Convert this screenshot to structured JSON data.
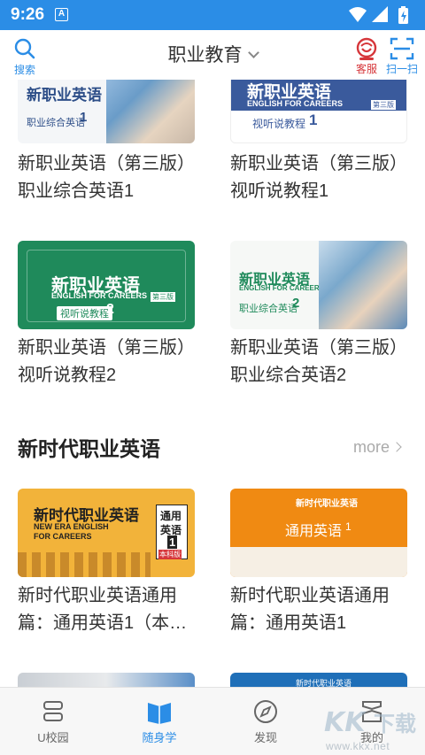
{
  "status_bar": {
    "time": "9:26",
    "notif": "A"
  },
  "header": {
    "search_label": "搜索",
    "title": "职业教育",
    "service_label": "客服",
    "scan_label": "扫一扫"
  },
  "books_top": [
    {
      "title": "新职业英语（第三版）职业综合英语1",
      "cover_title": "新职业英语",
      "cover_sub": "职业综合英语",
      "cover_num": "1"
    },
    {
      "title": "新职业英语（第三版）视听说教程1",
      "cover_title": "新职业英语",
      "cover_en": "ENGLISH FOR CAREERS",
      "cover_sub": "视听说教程",
      "cover_num": "1",
      "badge": "第三版"
    },
    {
      "title": "新职业英语（第三版）视听说教程2",
      "cover_title": "新职业英语",
      "cover_en": "ENGLISH FOR CAREERS",
      "cover_sub": "视听说教程",
      "cover_num": "2",
      "badge": "第三版"
    },
    {
      "title": "新职业英语（第三版）职业综合英语2",
      "cover_title": "新职业英语",
      "cover_en": "ENGLISH FOR CAREERS",
      "cover_sub": "职业综合英语",
      "cover_num": "2"
    }
  ],
  "section": {
    "title": "新时代职业英语",
    "more": "more"
  },
  "books_section": [
    {
      "title": "新时代职业英语通用篇：通用英语1（本…",
      "cover_title": "新时代职业英语",
      "cover_en1": "NEW ERA ENGLISH",
      "cover_en2": "FOR CAREERS",
      "side_a": "通用",
      "side_b": "英语",
      "side_num": "1",
      "side_tag": "本科版"
    },
    {
      "title": "新时代职业英语通用篇：通用英语1",
      "cover_title": "新时代职业英语",
      "cover_sub": "通用英语",
      "cover_num": "1"
    }
  ],
  "books_bottom": [
    {
      "cover_title": "新时代职业英语"
    }
  ],
  "bottom_nav": [
    {
      "label": "U校园",
      "active": false
    },
    {
      "label": "随身学",
      "active": true
    },
    {
      "label": "发现",
      "active": false
    },
    {
      "label": "我的",
      "active": false
    }
  ],
  "watermark": {
    "mark": "KK下载",
    "url": "www.kkx.net"
  },
  "colors": {
    "primary": "#2b8de6",
    "service": "#d6363a",
    "green": "#1f8a5b",
    "navy": "#3a5a9c",
    "yellow": "#f2b33a",
    "orange": "#f08a12"
  }
}
